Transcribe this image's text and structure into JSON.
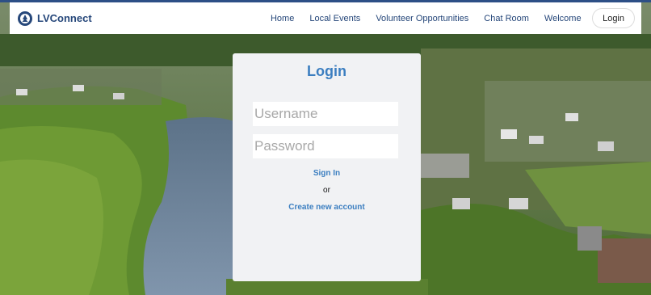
{
  "brand": {
    "name": "LVConnect",
    "logo_icon": "tree-logo-icon"
  },
  "nav": {
    "links": [
      "Home",
      "Local Events",
      "Volunteer Opportunities",
      "Chat Room",
      "Welcome"
    ],
    "login_label": "Login"
  },
  "login": {
    "title": "Login",
    "username_placeholder": "Username",
    "password_placeholder": "Password",
    "signin_label": "Sign In",
    "or_text": "or",
    "create_label": "Create new account"
  },
  "colors": {
    "accent": "#3b7ec0",
    "brand": "#26477a",
    "card_bg": "#f1f2f4"
  }
}
